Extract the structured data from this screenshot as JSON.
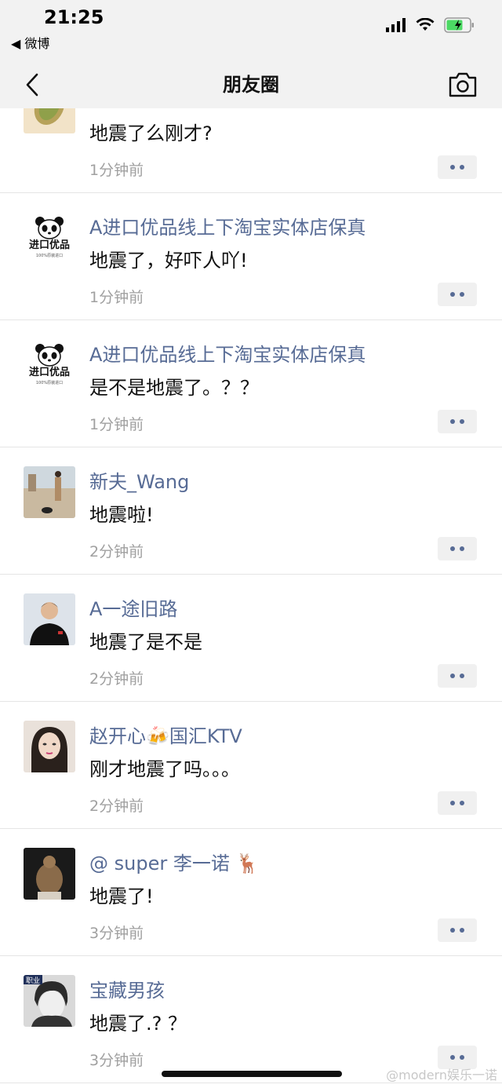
{
  "status_bar": {
    "time": "21:25",
    "back_app": "◀ 微博"
  },
  "nav": {
    "title": "朋友圈",
    "back_icon": "chevron-left-icon",
    "camera_icon": "camera-icon"
  },
  "feed": [
    {
      "nickname": "",
      "text": "地震了么刚才?",
      "time": "1分钟前"
    },
    {
      "nickname": "A进口优品线上下淘宝实体店保真",
      "text": "地震了，好吓人吖!",
      "time": "1分钟前"
    },
    {
      "nickname": "A进口优品线上下淘宝实体店保真",
      "text": "是不是地震了。？？",
      "time": "1分钟前"
    },
    {
      "nickname": "新夫_Wang",
      "text": "地震啦!",
      "time": "2分钟前"
    },
    {
      "nickname": "A一途旧路",
      "text": "地震了是不是",
      "time": "2分钟前"
    },
    {
      "nickname": "赵开心🍻国汇KTV",
      "text": "刚才地震了吗。。。",
      "time": "2分钟前"
    },
    {
      "nickname": "@ super 李一诺 🦌",
      "text": "地震了!",
      "time": "3分钟前"
    },
    {
      "nickname": "宝藏男孩",
      "text": "地震了.? ？",
      "time": "3分钟前"
    }
  ],
  "panda_avatar_text": {
    "brand": "进口优品",
    "sub": "100%原装进口"
  },
  "avatar_badge": "职业",
  "watermark": "@modern娱乐一诺",
  "colors": {
    "nickname": "#576b95",
    "header_bg": "#f2f2f2",
    "battery": "#4cd964"
  }
}
